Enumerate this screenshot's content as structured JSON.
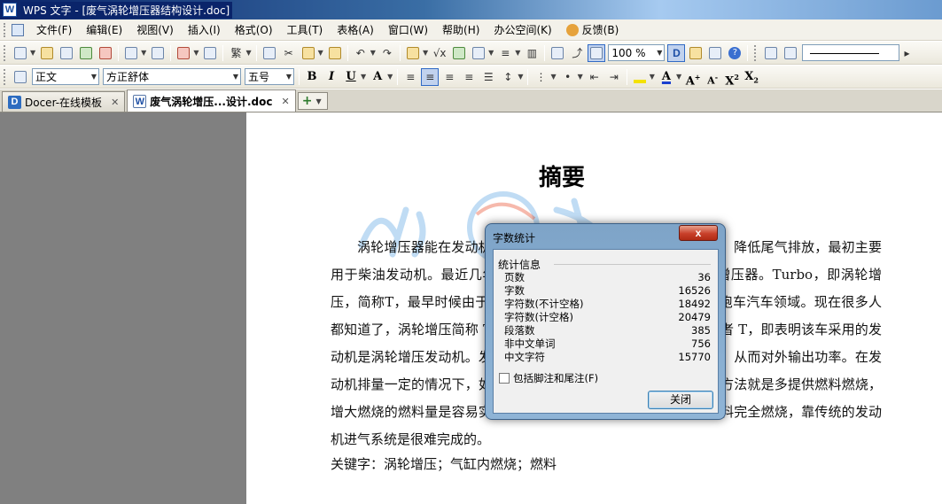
{
  "window": {
    "title": "WPS 文字 - [废气涡轮增压器结构设计.doc]",
    "app_icon_letter": "W"
  },
  "menu": {
    "items": [
      "文件(F)",
      "编辑(E)",
      "视图(V)",
      "插入(I)",
      "格式(O)",
      "工具(T)",
      "表格(A)",
      "窗口(W)",
      "帮助(H)",
      "办公空间(K)"
    ],
    "feedback": "反馈(B)"
  },
  "toolbar": {
    "zoom": "100 %",
    "style": "正文",
    "font": "方正舒体",
    "size": "五号",
    "font_color": "#1a3fcf",
    "highlight_color": "#f4e200"
  },
  "tabs": [
    {
      "label": "Docer-在线模板",
      "icon_letter": "D",
      "active": false
    },
    {
      "label": "废气涡轮增压...设计.doc",
      "icon_letter": "W",
      "active": true
    }
  ],
  "document": {
    "title": "摘要",
    "body": "涡轮增压器能在发动机排量不变的情况下大幅提升发动机功率，降低尾气排放，最初主要用于柴油发动机。最近几年汽油发动机上也越来越多的使用涡轮增压器。Turbo，即涡轮增压，简称T，最早时候由于可以大幅提升功率被广泛应用于赛车及跑车汽车领域。现在很多人都知道了，涡轮增压简称 Turbo，如果在轿车尾部看到 Turbo 或者 T，即表明该车采用的发动机是涡轮增压发动机。发动机是靠燃料在发动机气缸内燃烧作功，从而对外输出功率。在发动机排量一定的情况下，如果要提高发动机的输出功率，最有效的方法就是多提供燃料燃烧，增大燃烧的燃料量是容易实现的，但要提供足够量的空气以支持燃料完全燃烧，靠传统的发动机进气系统是很难完成的。",
    "keywords": "关键字：涡轮增压；气缸内燃烧；燃料"
  },
  "dialog": {
    "title": "字数统计",
    "close_symbol": "x",
    "group_title": "统计信息",
    "stats": [
      {
        "label": "页数",
        "value": "36"
      },
      {
        "label": "字数",
        "value": "16526"
      },
      {
        "label": "字符数(不计空格)",
        "value": "18492"
      },
      {
        "label": "字符数(计空格)",
        "value": "20479"
      },
      {
        "label": "段落数",
        "value": "385"
      },
      {
        "label": "非中文单词",
        "value": "756"
      },
      {
        "label": "中文字符",
        "value": "15770"
      }
    ],
    "checkbox_label": "包括脚注和尾注(F)",
    "close_button": "关闭"
  }
}
